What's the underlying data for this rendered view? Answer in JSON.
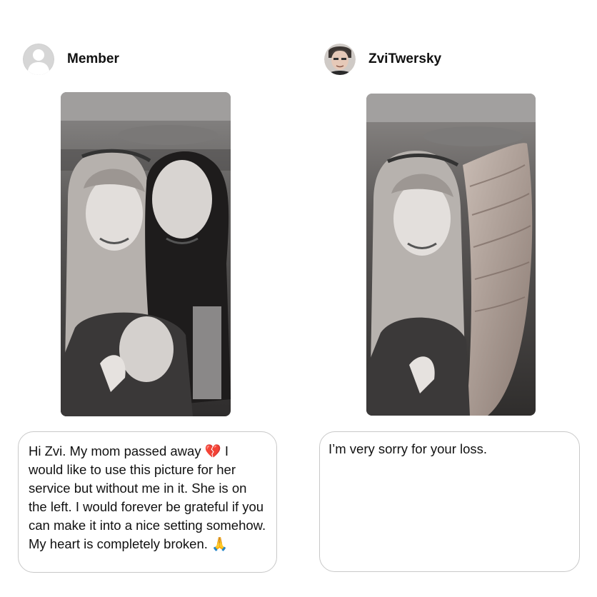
{
  "left": {
    "username": "Member",
    "avatar_icon": "default-user-icon",
    "message": "Hi Zvi. My mom passed away 💔 I would like to use this picture for her service but without me in it. She is on the left. I would forever be grateful if you can make it into a nice setting somehow. My heart is completely broken. 🙏"
  },
  "right": {
    "username": "ZviTwersky",
    "avatar_icon": "profile-photo",
    "message": "I’m very sorry for your loss."
  },
  "colors": {
    "bubble_border": "#c8c8c8",
    "text": "#111111",
    "avatar_placeholder": "#d6d6d6"
  }
}
